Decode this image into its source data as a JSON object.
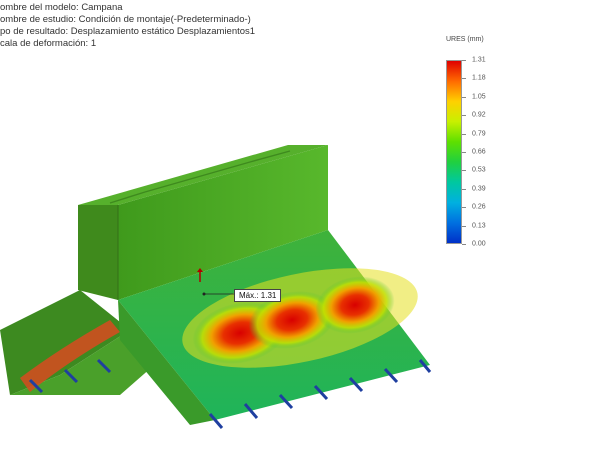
{
  "info": {
    "model": "ombre del modelo: Campana",
    "study": "ombre de estudio: Condición de montaje(-Predeterminado-)",
    "result": "po de resultado: Desplazamiento estático Desplazamientos1",
    "scale": "cala de deformación: 1"
  },
  "legend": {
    "title": "URES (mm)",
    "ticks": [
      "1.31",
      "1.18",
      "1.05",
      "0.92",
      "0.79",
      "0.66",
      "0.53",
      "0.39",
      "0.26",
      "0.13",
      "0.00"
    ],
    "colors": [
      "#e00000",
      "#ff6a00",
      "#ffd000",
      "#c8f000",
      "#5ee000",
      "#20d040",
      "#00c8a0",
      "#00b0e0",
      "#0070e0",
      "#0030c8"
    ]
  },
  "probe": {
    "label": "Máx.: 1.31"
  }
}
